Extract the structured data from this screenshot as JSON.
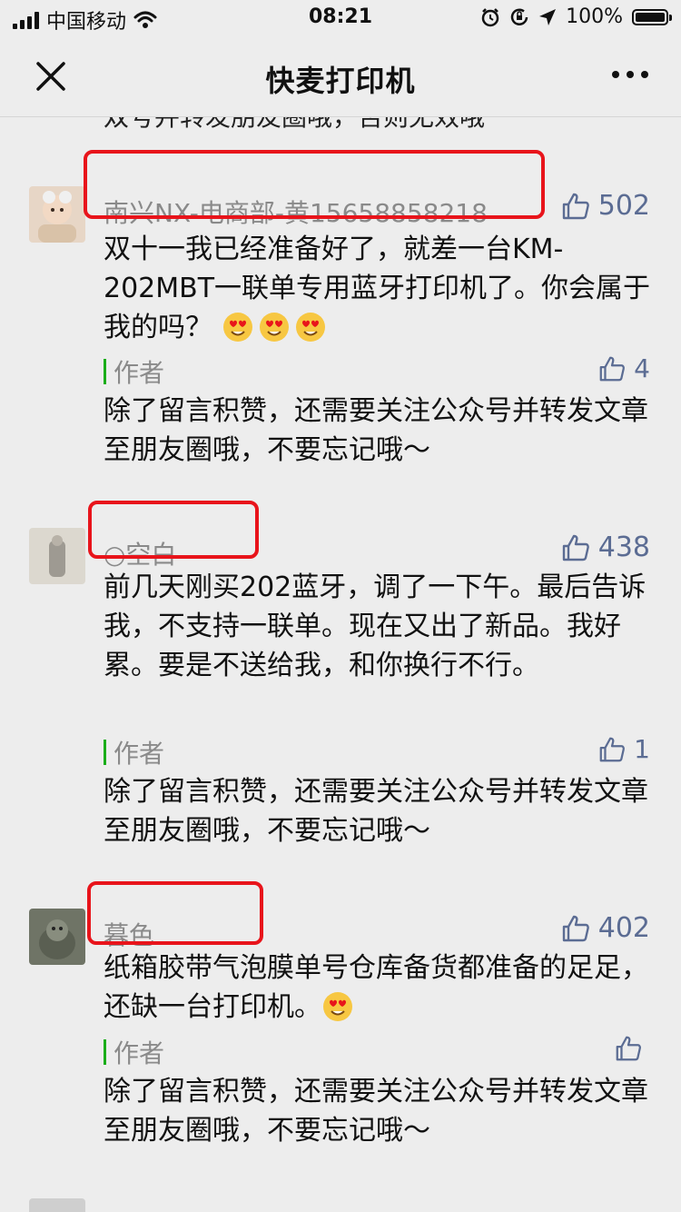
{
  "status_bar": {
    "carrier": "中国移动",
    "time": "08:21",
    "battery": "100%",
    "battery_level": 1.0
  },
  "nav": {
    "title": "快麦打印机"
  },
  "cut_top_text": "双号并转发朋友圈哦，否则无效哦",
  "comments": [
    {
      "nickname": "南兴NX-电商部-黄15658858218",
      "likes": "502",
      "text": "双十一我已经准备好了，就差一台KM-202MBT一联单专用蓝牙打印机了。你会属于我的吗？",
      "emojis": 3,
      "reply": {
        "label": "作者",
        "likes": "4",
        "text": "除了留言积赞，还需要关注公众号并转发文章至朋友圈哦，不要忘记哦～"
      }
    },
    {
      "nickname": "○空白",
      "likes": "438",
      "text": "前几天刚买202蓝牙，调了一下午。最后告诉我，不支持一联单。现在又出了新品。我好累。要是不送给我，和你换行不行。",
      "emojis": 0,
      "reply": {
        "label": "作者",
        "likes": "1",
        "text": "除了留言积赞，还需要关注公众号并转发文章至朋友圈哦，不要忘记哦～"
      }
    },
    {
      "nickname": "暮色",
      "likes": "402",
      "text": "纸箱胶带气泡膜单号仓库备货都准备的足足，还缺一台打印机。",
      "emojis": 1,
      "reply": {
        "label": "作者",
        "likes": "",
        "text": "除了留言积赞，还需要关注公众号并转发文章至朋友圈哦，不要忘记哦～"
      }
    }
  ],
  "colors": {
    "background": "#ededed",
    "like_blue": "#5b6c93",
    "nickname_gray": "#8a8a8a",
    "author_green": "#1aad19",
    "highlight_red": "#e8141b"
  }
}
